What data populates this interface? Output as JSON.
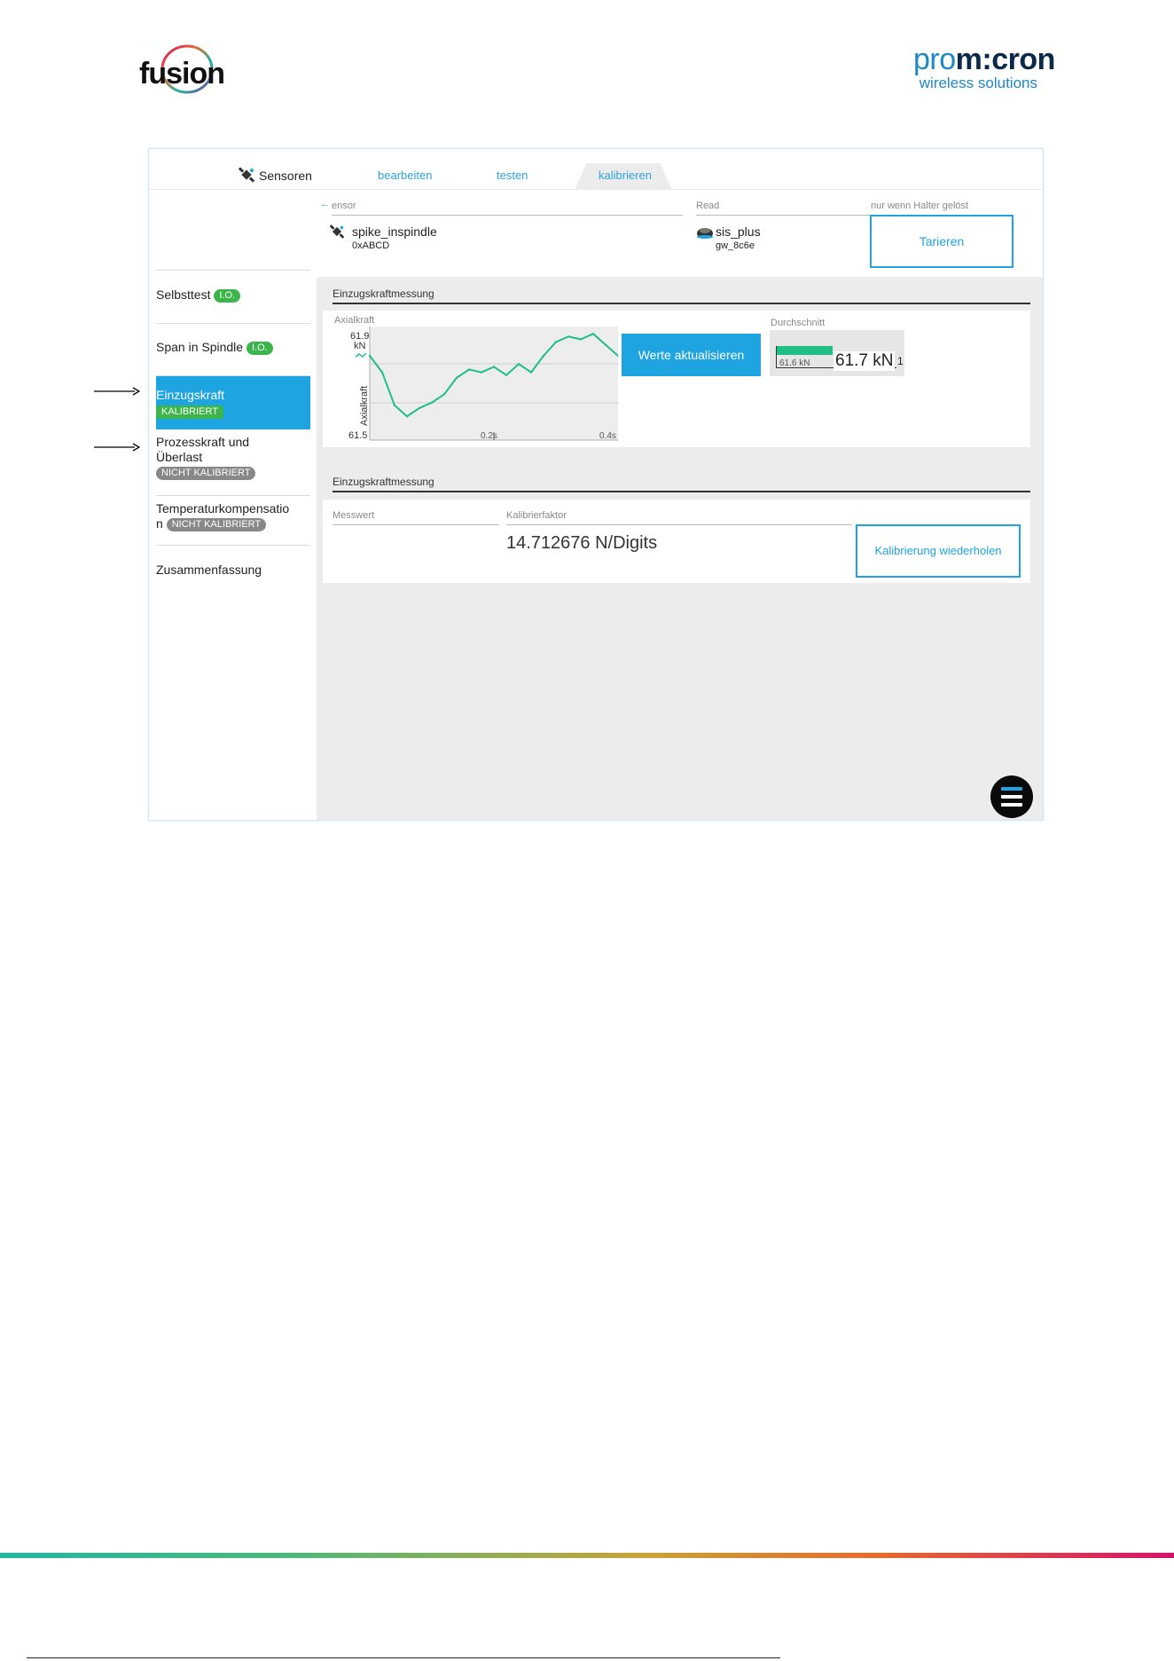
{
  "logos": {
    "fusion": "fusion",
    "promicron_main": "promicron",
    "promicron_pro": "pro",
    "promicron_rest": "m:cron",
    "promicron_tagline": "wireless solutions"
  },
  "topbar": {
    "sensoren": "Sensoren",
    "bearbeiten": "bearbeiten",
    "testen": "testen",
    "kalibrieren": "kalibrieren"
  },
  "sidebar": {
    "items": [
      {
        "label": "Selbsttest",
        "badge": "I.O."
      },
      {
        "label": "Span in Spindle",
        "badge": "I.O."
      },
      {
        "label": "Einzugskraft",
        "badge": "KALIBRIERT"
      },
      {
        "label": "Prozesskraft und Überlast",
        "line1": "Prozesskraft und",
        "line2": "Überlast",
        "badge": "NICHT KALIBRIERT"
      },
      {
        "label": "Temperaturkompensation",
        "line1": "Temperaturkompensatio",
        "line2": "n",
        "badge": "NICHT KALIBRIERT"
      },
      {
        "label": "Zusammenfassung"
      }
    ]
  },
  "header": {
    "sensor_label": "ensor",
    "sensor_name": "spike_inspindle",
    "sensor_id": "0xABCD",
    "read_label": "Read",
    "reader_name": "sis_plus",
    "reader_id": "gw_8c6e",
    "tare_hint": "nur wenn Halter gelöst",
    "tare_button": "Tarieren"
  },
  "section1": {
    "title": "Einzugskraftmessung",
    "chart_label": "Axialkraft",
    "update_button": "Werte aktualisieren",
    "avg_label": "Durchschnitt",
    "avg_small": "61.6 kN",
    "avg_value": "61.7 kN",
    "avg_tail": "1"
  },
  "chart_data": {
    "type": "line",
    "title": "Axialkraft",
    "ylabel": "Axialkraft",
    "yunit": "kN",
    "ylim": [
      61.5,
      61.9
    ],
    "ytick_labels": [
      "61.9",
      "61.5"
    ],
    "xtick_labels": [
      "0.2s",
      "0.4s"
    ],
    "xlim": [
      0.0,
      0.4
    ],
    "color": "#1fbf86",
    "series": [
      {
        "x": [
          0.0,
          0.02,
          0.04,
          0.06,
          0.08,
          0.1,
          0.12,
          0.14,
          0.16,
          0.18,
          0.2,
          0.22,
          0.24,
          0.26,
          0.28,
          0.3,
          0.32,
          0.34,
          0.36,
          0.38,
          0.4
        ],
        "values": [
          61.8,
          61.74,
          61.62,
          61.58,
          61.61,
          61.63,
          61.66,
          61.72,
          61.75,
          61.74,
          61.76,
          61.73,
          61.77,
          61.74,
          61.8,
          61.85,
          61.87,
          61.86,
          61.88,
          61.84,
          61.8
        ]
      }
    ]
  },
  "section2": {
    "title": "Einzugskraftmessung",
    "messwert_label": "Messwert",
    "kalibrierfaktor_label": "Kalibrierfaktor",
    "kalibrierfaktor_value": "14.712676 N/Digits",
    "repeat_button": "Kalibrierung wiederholen"
  }
}
